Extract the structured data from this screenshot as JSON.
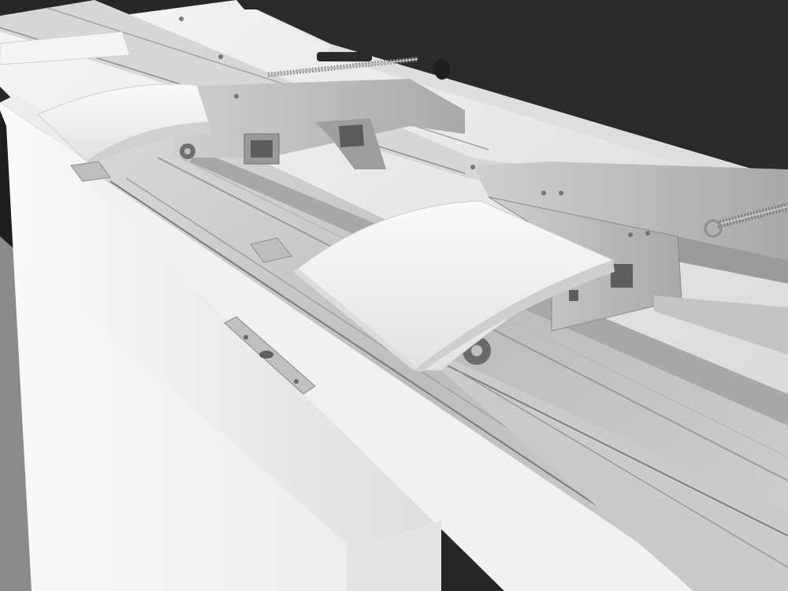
{
  "image": {
    "subject": "sliding-door-track-mechanism",
    "palette": {
      "background": "#262626",
      "housing": "#eaeaea",
      "panel": "#f2f2f2",
      "rail": "#c9c9c9",
      "metal": "#b4b4b4",
      "shadow": "#8a8a8a",
      "carriage_cover": "#f6f6f6",
      "spring": "#909090",
      "knob": "#1e1e1e"
    }
  }
}
